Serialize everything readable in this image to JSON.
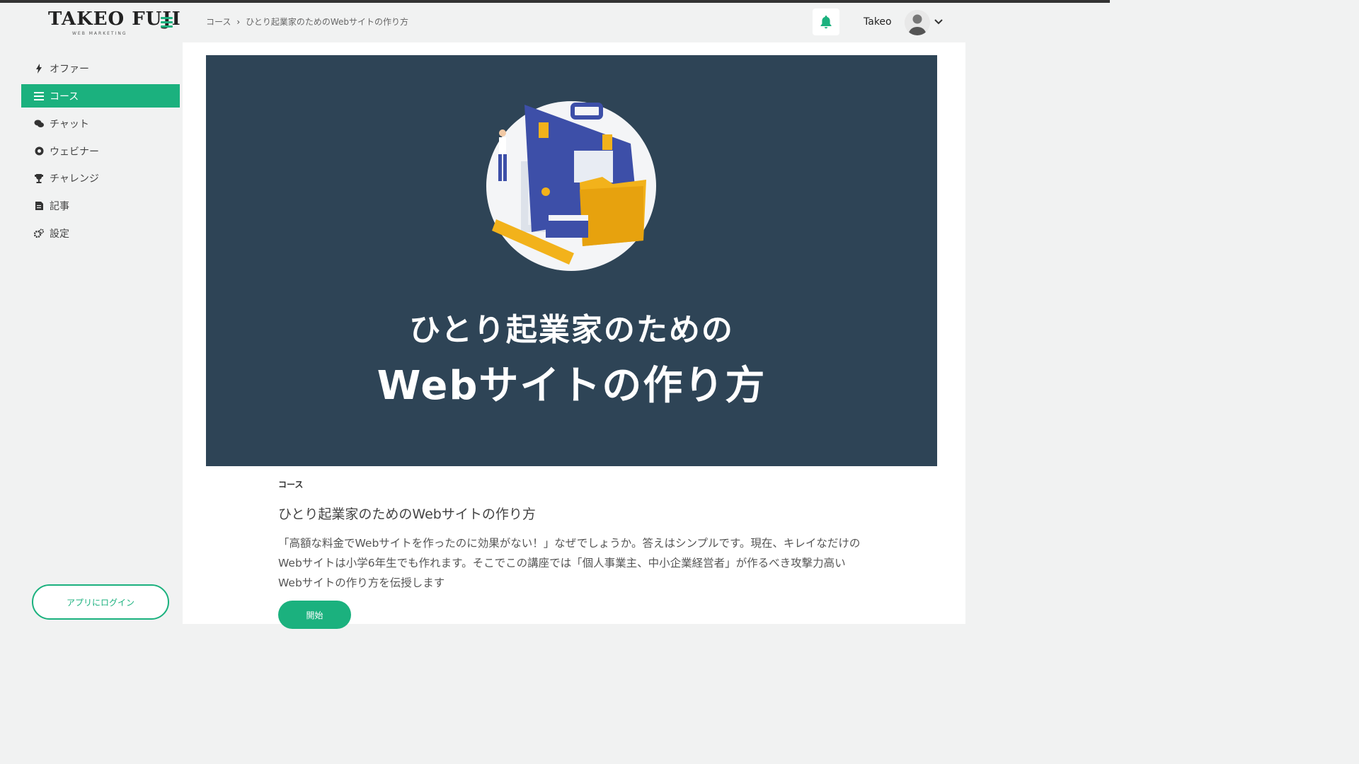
{
  "brand": {
    "logo_text": "TAKEO FUJI",
    "logo_sub": "WEB MARKETING"
  },
  "breadcrumb": {
    "root": "コース",
    "separator": "›",
    "current": "ひとり起業家のためのWebサイトの作り方"
  },
  "header": {
    "username": "Takeo"
  },
  "sidebar": {
    "items": [
      {
        "label": "オファー",
        "icon": "bolt-icon"
      },
      {
        "label": "コース",
        "icon": "list-icon"
      },
      {
        "label": "チャット",
        "icon": "chat-icon"
      },
      {
        "label": "ウェビナー",
        "icon": "webinar-icon"
      },
      {
        "label": "チャレンジ",
        "icon": "trophy-icon"
      },
      {
        "label": "記事",
        "icon": "article-icon"
      },
      {
        "label": "設定",
        "icon": "gear-icon"
      }
    ],
    "app_login": "アプリにログイン"
  },
  "hero": {
    "title_line1": "ひとり起業家のための",
    "title_line2": "Webサイトの作り方"
  },
  "course": {
    "label": "コース",
    "title": "ひとり起業家のためのWebサイトの作り方",
    "description": "「高額な料金でWebサイトを作ったのに効果がない！」なぜでしょうか。答えはシンプルです。現在、キレイなだけのWebサイトは小学6年生でも作れます。そこでこの講座では「個人事業主、中小企業経営者」が作るべき攻撃力高いWebサイトの作り方を伝授します",
    "start_button": "開始"
  },
  "colors": {
    "accent": "#1bb17e",
    "hero_bg": "#2e4456",
    "illustration_blue": "#3d4fa8",
    "illustration_yellow": "#f2b21b"
  }
}
